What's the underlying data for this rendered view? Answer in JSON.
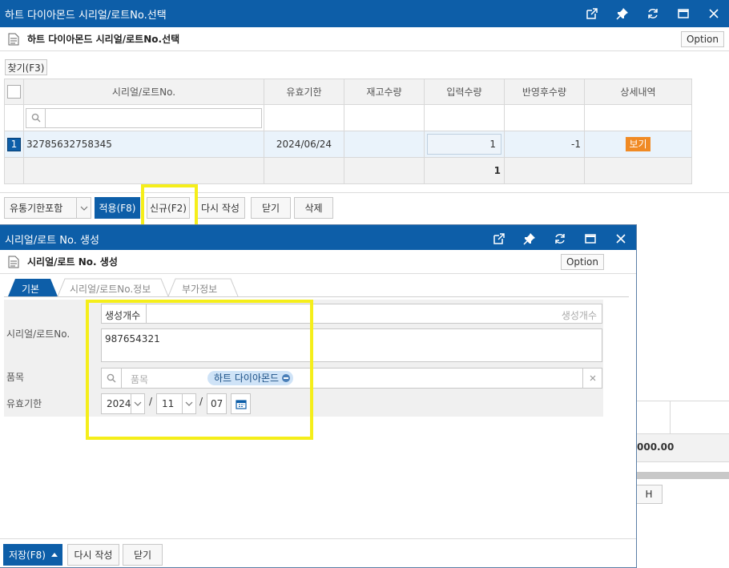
{
  "main_window": {
    "title": "하트 다이아몬드 시리얼/로트No.선택",
    "subheader_title": "하트 다이아몬드 시리얼/로트No.선택",
    "option_label": "Option",
    "find_label": "찾기(F3)",
    "columns": [
      "시리얼/로트No.",
      "유효기한",
      "재고수량",
      "입력수량",
      "반영후수량",
      "상세내역"
    ],
    "row": {
      "index": "1",
      "serial": "32785632758345",
      "expiry": "2024/06/24",
      "stock": "",
      "input_qty": "1",
      "after_qty": "-1",
      "detail_label": "보기"
    },
    "total_input_qty": "1",
    "footer": {
      "dropdown_value": "유통기한포함",
      "apply_label": "적용(F8)",
      "new_label": "신규(F2)",
      "rewrite_label": "다시 작성",
      "close_label": "닫기",
      "delete_label": "삭제"
    }
  },
  "background_fragments": {
    "amount_text": "000.00",
    "button_text": "H"
  },
  "dialog": {
    "title": "시리얼/로트 No. 생성",
    "subheader_title": "시리얼/로트 No. 생성",
    "option_label": "Option",
    "tabs": [
      "기본",
      "시리얼/로트No.정보",
      "부가정보"
    ],
    "active_tab": 0,
    "form": {
      "count_label": "생성개수",
      "count_placeholder": "생성개수",
      "serial_label": "시리얼/로트No.",
      "serial_value": "987654321",
      "item_label": "품목",
      "item_placeholder": "품목",
      "item_chip": "하트 다이아몬드",
      "expiry_label": "유효기한",
      "year": "2024",
      "month": "11",
      "day": "07",
      "date_sep": "/"
    },
    "footer": {
      "save_label": "저장(F8)",
      "rewrite_label": "다시 작성",
      "close_label": "닫기"
    }
  },
  "colors": {
    "titlebar": "#0d5ea8",
    "highlight": "#f5ee1a",
    "detail_badge": "#f08a24",
    "chip": "#cfe3f7"
  }
}
